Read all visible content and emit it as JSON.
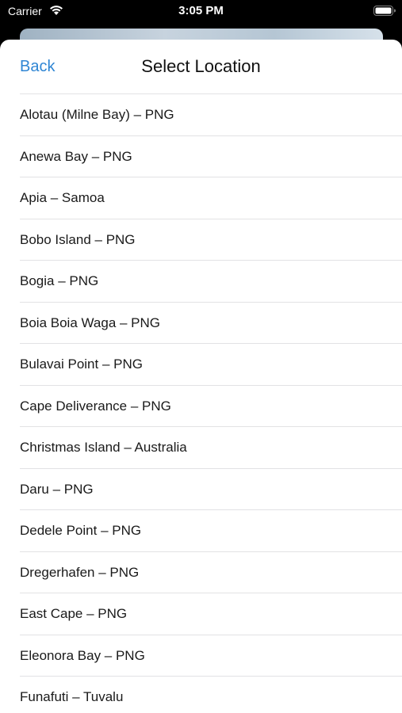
{
  "status_bar": {
    "carrier": "Carrier",
    "time": "3:05 PM"
  },
  "nav": {
    "back_label": "Back",
    "title": "Select Location"
  },
  "locations": [
    "Alotau (Milne Bay) – PNG",
    "Anewa Bay – PNG",
    "Apia – Samoa",
    "Bobo Island – PNG",
    "Bogia – PNG",
    "Boia Boia Waga – PNG",
    "Bulavai Point – PNG",
    "Cape Deliverance – PNG",
    "Christmas Island – Australia",
    "Daru – PNG",
    "Dedele Point – PNG",
    "Dregerhafen – PNG",
    "East Cape – PNG",
    "Eleonora Bay – PNG",
    "Funafuti – Tuvalu"
  ],
  "colors": {
    "accent": "#2f86d4",
    "separator": "#e2e2e4",
    "text": "#1a1a1a"
  },
  "icons": {
    "wifi": "wifi-icon",
    "battery": "battery-icon"
  }
}
